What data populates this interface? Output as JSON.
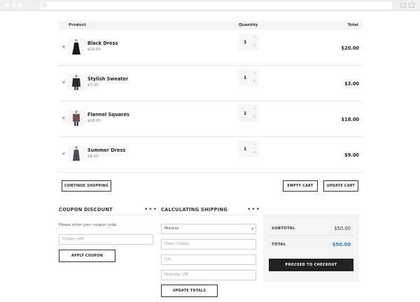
{
  "browser": {
    "icons": [
      "dot-icon",
      "search-icon",
      "window-icon"
    ]
  },
  "cart": {
    "headers": {
      "product": "Product",
      "quantity": "Quantity",
      "total": "Total"
    },
    "items": [
      {
        "name": "Black Dress",
        "price": "$20.00",
        "qty": "1",
        "total": "$20.00"
      },
      {
        "name": "Stylish Sweater",
        "price": "$3.00",
        "qty": "1",
        "total": "$3.00"
      },
      {
        "name": "Flannel Squares",
        "price": "$18.00",
        "qty": "1",
        "total": "$18.00"
      },
      {
        "name": "Summer Dress",
        "price": "$9.00",
        "qty": "1",
        "total": "$9.00"
      }
    ],
    "remove_icon": "×",
    "qty_up_icon": "^",
    "qty_down_icon": "v"
  },
  "actions": {
    "continue_shopping": "Continue Shopping",
    "empty_cart": "Empty Cart",
    "update_cart": "Update Cart"
  },
  "coupon": {
    "title": "Coupon Discount",
    "more": "•••",
    "description": "Please enter your coupon code.",
    "placeholder": "Coupon code",
    "button": "Apply Coupon"
  },
  "shipping": {
    "title": "Calculating Shipping",
    "more": "•••",
    "country": "Morocco",
    "state_placeholder": "State / County",
    "city_placeholder": "City",
    "postcode_placeholder": "Postcode / ZIP",
    "button": "Update Totals"
  },
  "totals": {
    "subtotal_label": "SUBTOTAL",
    "subtotal_value": "$50.00",
    "total_label": "TOTAL",
    "total_value": "$50.00",
    "checkout_button": "Proceed to Checkout"
  },
  "colors": {
    "accent": "#2a80c7",
    "dark": "#222222",
    "panel": "#f4f4f4"
  }
}
